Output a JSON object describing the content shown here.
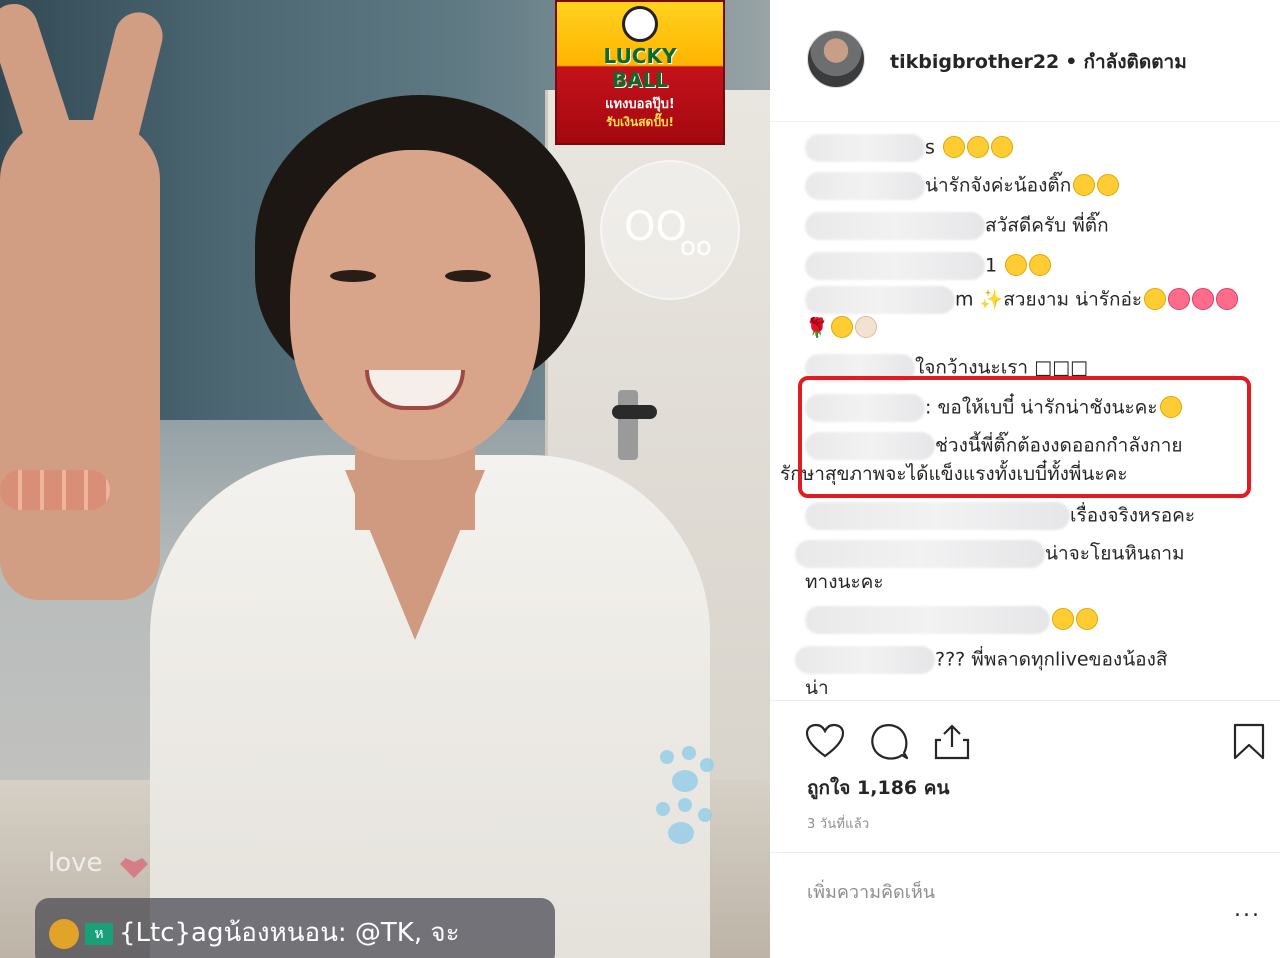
{
  "live_video": {
    "badge": {
      "line1": "LUCKY",
      "line2": "BALL",
      "line3": "แทงบอลปุ๊บ!",
      "line4": "รับเงินสดปั๊บ!"
    },
    "love_label": "love",
    "live_comment": {
      "badge_letter": "ห",
      "text": "{Ltc}agน้องหนอน: @TK, จะ"
    }
  },
  "post": {
    "username": "tikbigbrother22",
    "separator": "•",
    "follow_status": "กำลังติดตาม",
    "comments": [
      {
        "text": "s "
      },
      {
        "text": "น่ารักจังค่ะน้องติ๊ก"
      },
      {
        "text": "สวัสดีครับ พี่ติ๊ก"
      },
      {
        "text": "1 "
      },
      {
        "text": "m ✨สวยงาม น่ารักอ่ะ"
      },
      {
        "text": "🌹"
      },
      {
        "text": "ใจกว้างนะเรา □□□"
      },
      {
        "text": ": ขอให้เบบี๋ น่ารักน่าชังนะคะ"
      },
      {
        "text": "ช่วงนี้พี่ติ๊กต้องงดออกกำลังกาย"
      },
      {
        "text": "รักษาสุขภาพจะได้แข็งแรงทั้งเบบี๋ทั้งพี่นะคะ"
      },
      {
        "text": "เรื่องจริงหรอคะ"
      },
      {
        "text": "น่าจะโยนหินถาม"
      },
      {
        "text": "ทางนะคะ"
      },
      {
        "text": ""
      },
      {
        "text": "??? พี่พลาดทุกliveของน้องสิ"
      },
      {
        "text": "น่า"
      }
    ],
    "likes": "ถูกใจ 1,186 คน",
    "time_ago": "3 วันที่แล้ว",
    "add_comment_placeholder": "เพิ่มความคิดเห็น",
    "more": "..."
  },
  "icons": [
    "heart-icon",
    "comment-icon",
    "share-icon",
    "bookmark-icon",
    "owl-icon",
    "paw-icon"
  ],
  "colors": {
    "highlight": "#e11b22",
    "text": "#262626",
    "muted": "#8e8e8e",
    "border": "#efefef"
  }
}
